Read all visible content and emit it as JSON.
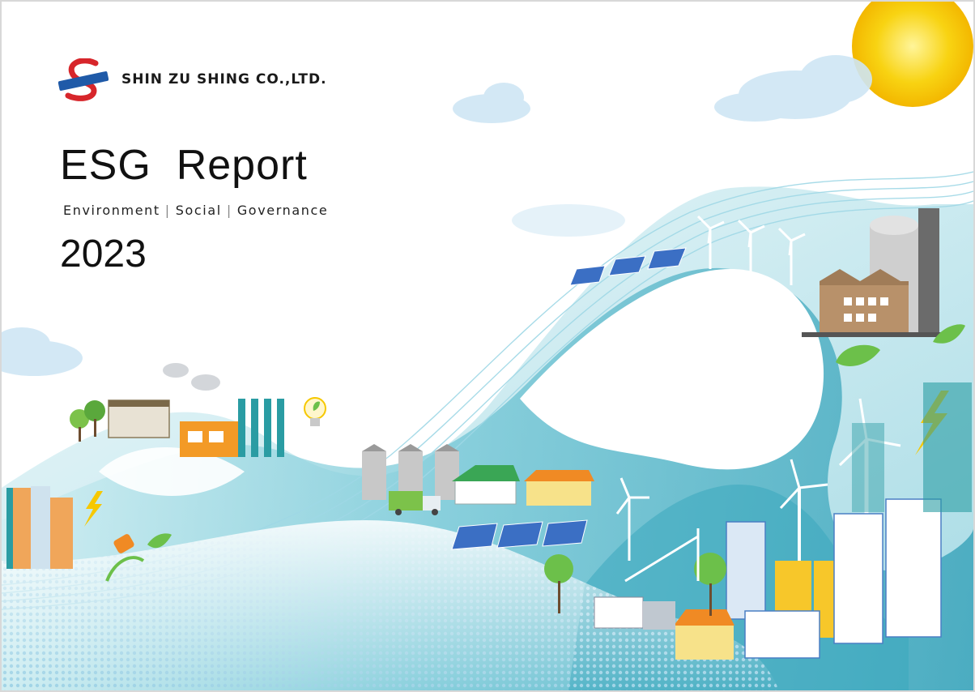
{
  "company": {
    "name": "SHIN ZU SHING CO.,LTD.",
    "logo_text": "SHIN ZU SHING"
  },
  "report": {
    "title": "ESG  Report",
    "subtitle_parts": [
      "Environment",
      "Social",
      "Governance"
    ],
    "year": "2023"
  },
  "colors": {
    "wave_light": "#cdeaf0",
    "wave_mid": "#8fd1dd",
    "wave_dark": "#3aa7bd",
    "sun": "#f6c800",
    "logo_red": "#d7262b",
    "logo_blue": "#1f5aa8"
  }
}
